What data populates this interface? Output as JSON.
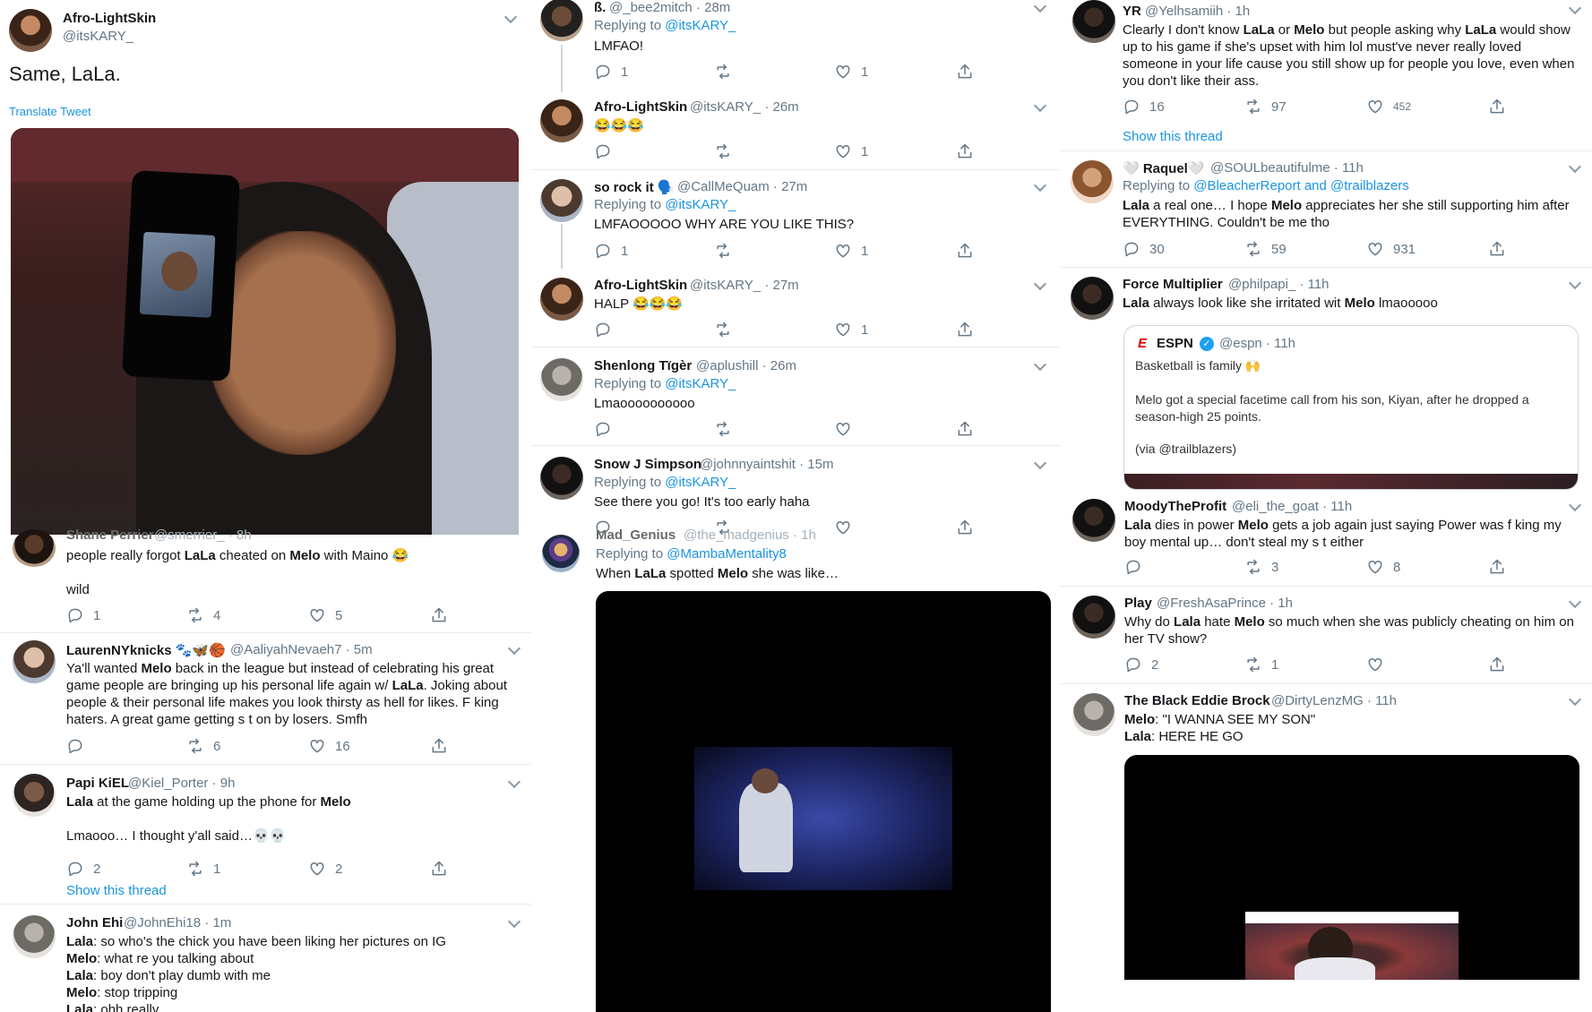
{
  "col1": {
    "main": {
      "name": "Afro-LightSkin",
      "handle": "@itsKARY_",
      "text": "Same, LaLa.",
      "translate": "Translate Tweet"
    },
    "shane": {
      "name": "Shane Perrier",
      "handle": "@smerrier_ · 8h",
      "text1": "people really forgot ",
      "b1": "LaLa",
      "text2": " cheated on ",
      "b2": "Melo",
      "text3": " with Maino 😂",
      "line2": "wild",
      "replies": "1",
      "retweets": "4",
      "likes": "5"
    },
    "lauren": {
      "name": "LaurenNYknicks 🐾🦋🏀",
      "handle": "@AaliyahNevaeh7 · 5m",
      "t1": "Ya'll wanted ",
      "b1": "Melo",
      "t2": " back in the league but instead of celebrating his great game people are bringing up his personal life again w/ ",
      "b2": "LaLa",
      "t3": ". Joking about people & their personal life makes you look thirsty as hell for likes. F   king haters. A great game getting s   t on by losers. Smfh",
      "replies": "",
      "retweets": "6",
      "likes": "16"
    },
    "papi": {
      "name": "Papi KiEL",
      "handle": "@Kiel_Porter · 9h",
      "b1": "Lala",
      "t1": " at the game holding up the phone for ",
      "b2": "Melo",
      "line2": "Lmaooo… I thought y'all said…💀💀",
      "replies": "2",
      "retweets": "1",
      "likes": "2",
      "show": "Show this thread"
    },
    "john": {
      "name": "John Ehi",
      "handle": "@JohnEhi18 · 1m",
      "l1b": "Lala",
      "l1": ": so who's the chick you have been liking her pictures on IG",
      "l2b": "Melo",
      "l2": ": what re you talking about",
      "l3b": "Lala",
      "l3": ": boy don't play dumb with me",
      "l4b": "Melo",
      "l4": ": stop tripping",
      "l5b": "Lala",
      "l5": ": ohh really"
    }
  },
  "col2": {
    "bee": {
      "name": "ß.",
      "handle": "@_bee2mitch · 28m",
      "replying": "Replying to ",
      "to": "@itsKARY_",
      "text": "LMFAO!",
      "replies": "1",
      "likes": "1"
    },
    "afro1": {
      "name": "Afro-LightSkin",
      "handle": "@itsKARY_ · 26m",
      "text": "😂😂😂",
      "likes": "1"
    },
    "rock": {
      "name": "so rock it 🗣️",
      "handle": "@CallMeQuam · 27m",
      "replying": "Replying to ",
      "to": "@itsKARY_",
      "text": "LMFAOOOOO WHY ARE YOU LIKE THIS?",
      "replies": "1",
      "likes": "1"
    },
    "afro2": {
      "name": "Afro-LightSkin",
      "handle": "@itsKARY_ · 27m",
      "text": "HALP 😂😂😂",
      "likes": "1"
    },
    "shen": {
      "name": "Shenlong Tïgèr",
      "handle": "@aplushill · 26m",
      "replying": "Replying to ",
      "to": "@itsKARY_",
      "text": "Lmaoooooooooo"
    },
    "snow": {
      "name": "Snow J Simpson",
      "handle": "@johnnyaintshit · 15m",
      "replying": "Replying to ",
      "to": "@itsKARY_",
      "text": "See there you go! It's too early haha"
    },
    "mad": {
      "name": "Mad_Genius",
      "handle": "@the_madgenius · 1h",
      "replying": "Replying to ",
      "to": "@MambaMentality8",
      "t1": "When ",
      "b1": "LaLa",
      "t2": " spotted ",
      "b2": "Melo",
      "t3": " she was like…"
    }
  },
  "col3": {
    "yr": {
      "name": "YR",
      "handle": "@Yelhsamiih · 1h",
      "t1": "Clearly I don't know ",
      "b1": "LaLa",
      "t2": " or ",
      "b2": "Melo",
      "t3": " but people asking why ",
      "b3": "LaLa",
      "t4": " would show up to his game if she's upset with him lol must've never really loved someone in your life cause you still show up for people you love, even when you don't like their ass.",
      "replies": "16",
      "retweets": "97",
      "likes": "452",
      "show": "Show this thread"
    },
    "raquel": {
      "name": "🤍 Raquel🤍",
      "handle": "@SOULbeautifulme · 11h",
      "replying": "Replying to ",
      "to": "@BleacherReport and @trailblazers",
      "b1": "Lala",
      "t1": " a real one… I hope ",
      "b2": "Melo",
      "t2": " appreciates her she still supporting him after EVERYTHING. Couldn't be me tho",
      "replies": "30",
      "retweets": "59",
      "likes": "931"
    },
    "force": {
      "name": "Force Multiplier",
      "handle": "@philpapi_ · 11h",
      "b1": "Lala",
      "t1": " always look like she irritated wit ",
      "b2": "Melo",
      "t2": " lmaooooo",
      "quote": {
        "logo": "E",
        "name": "ESPN",
        "handle": "@espn · 11h",
        "l1": "Basketball is family 🙌",
        "l2": "Melo got a special facetime call from his son, Kiyan, after he dropped a season-high 25 points.",
        "l3": "(via @trailblazers)"
      }
    },
    "moody": {
      "name": "MoodyTheProfit",
      "handle": "@eli_the_goat · 11h",
      "b1": "Lala",
      "t1": " dies in power ",
      "b2": "Melo",
      "t2": " gets a job again just saying Power was f   king my boy mental up… don't steal my s   t either",
      "retweets": "3",
      "likes": "8"
    },
    "play": {
      "name": "Play",
      "handle": "@FreshAsaPrince · 1h",
      "t1": "Why do ",
      "b1": "Lala",
      "t2": " hate ",
      "b2": "Melo",
      "t3": " so much when she was publicly cheating on him on her TV show?",
      "replies": "2",
      "retweets": "1"
    },
    "eddie": {
      "name": "The Black Eddie Brock",
      "handle": "@DirtyLenzMG · 11h",
      "l1b": "Melo",
      "l1": ": \"I WANNA SEE MY SON\"",
      "l2b": "Lala",
      "l2": ": HERE HE GO"
    }
  }
}
